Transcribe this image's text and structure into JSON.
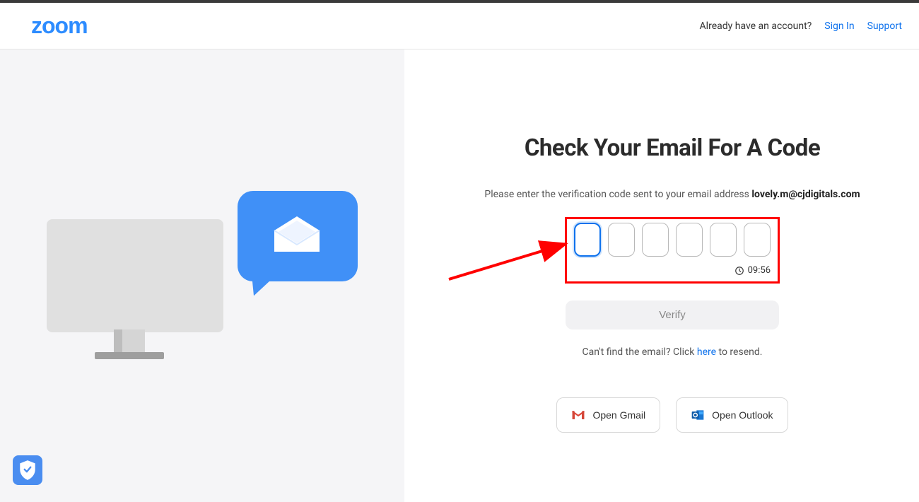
{
  "header": {
    "logo": "zoom",
    "account_prompt": "Already have an account?",
    "signin": "Sign In",
    "support": "Support"
  },
  "main": {
    "title": "Check Your Email For A Code",
    "subtitle_pre": "Please enter the verification code sent to your email address ",
    "email": "lovely.m@cjdigitals.com",
    "timer": "09:56",
    "verify_label": "Verify",
    "resend_pre": "Can't find the email? Click ",
    "resend_link": "here",
    "resend_post": " to resend.",
    "open_gmail": "Open Gmail",
    "open_outlook": "Open Outlook"
  }
}
